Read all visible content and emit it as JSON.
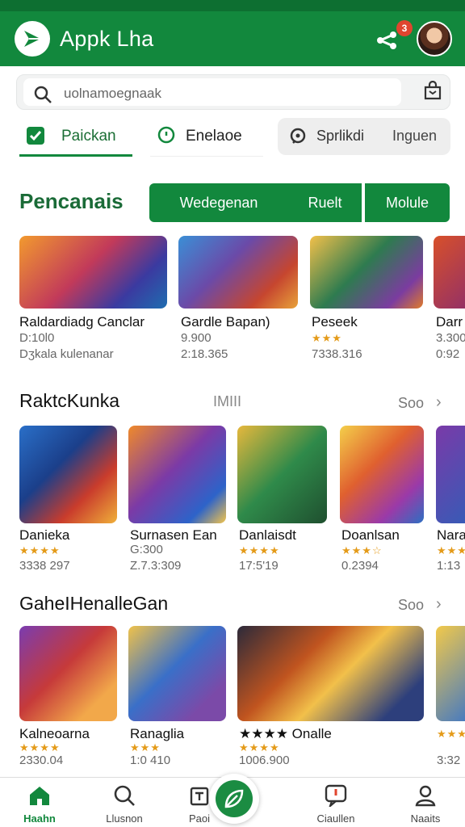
{
  "header": {
    "title": "Appk Lha",
    "badge_count": "3",
    "colors": {
      "primary": "#12883d",
      "badge": "#e0452f"
    }
  },
  "search": {
    "placeholder": "uolnamoegnaak"
  },
  "tabs": [
    {
      "label": "Paickan",
      "icon": "check-square-icon",
      "selected": true
    },
    {
      "label": "Enelaoe",
      "icon": "location-pin-icon",
      "selected": false
    }
  ],
  "pill": {
    "label1": "Sprlikdi",
    "label2": "Inguen",
    "icon": "chat-bubble-icon"
  },
  "section1": {
    "title": "Pencanais",
    "segments": [
      "Wedegenan",
      "Ruelt",
      "Molule"
    ],
    "cards": [
      {
        "title": "Raldardiadg Canclar",
        "line1": "D:10l0",
        "line2": "Dʒkala kulenanar"
      },
      {
        "title": "Gardle Bapan)",
        "line1": "9.900",
        "line2": "2:18.365"
      },
      {
        "title": "Peseek",
        "rating": "★★★",
        "line2": "7338.316"
      },
      {
        "title": "Darr",
        "line1": "3.300",
        "line2": "0:92"
      }
    ]
  },
  "section2": {
    "title": "RaktcKunka",
    "aside": "IMIII",
    "see_all": "Soo",
    "cards": [
      {
        "title": "Danieka",
        "rating": "★★★★",
        "line2": "3338 297"
      },
      {
        "title": "Surnasen Ean",
        "line1": "G:300",
        "line2": "Z.7.3:309"
      },
      {
        "title": "Danlaisdt",
        "rating": "★★★★",
        "line2": "17:5'19"
      },
      {
        "title": "Doanlsan",
        "rating": "★★★☆",
        "line2": "0.2394"
      },
      {
        "title": "Nara",
        "rating": "★★★",
        "line2": "1:13"
      }
    ]
  },
  "section3": {
    "title": "GaheIHenalleGan",
    "see_all": "Soo",
    "cards": [
      {
        "title": "Kalneoarna",
        "rating": "★★★★",
        "line2": "2330.04"
      },
      {
        "title": "Ranaglia",
        "rating": "★★★",
        "line2": "1:0 410"
      },
      {
        "title": "★★★★ Onalle",
        "rating": "★★★★",
        "line2": "1006.900"
      },
      {
        "title": "",
        "rating": "★★★",
        "line2": "3:32"
      }
    ]
  },
  "bottom_nav": [
    {
      "label": "Haahn",
      "icon": "home-icon",
      "active": true
    },
    {
      "label": "Llusnon",
      "icon": "search-icon",
      "active": false
    },
    {
      "label": "Paoi",
      "icon": "shop-icon",
      "active": false
    },
    {
      "label": "Ciaullen",
      "icon": "chat-icon",
      "active": false
    },
    {
      "label": "Naaits",
      "icon": "profile-icon",
      "active": false
    }
  ]
}
